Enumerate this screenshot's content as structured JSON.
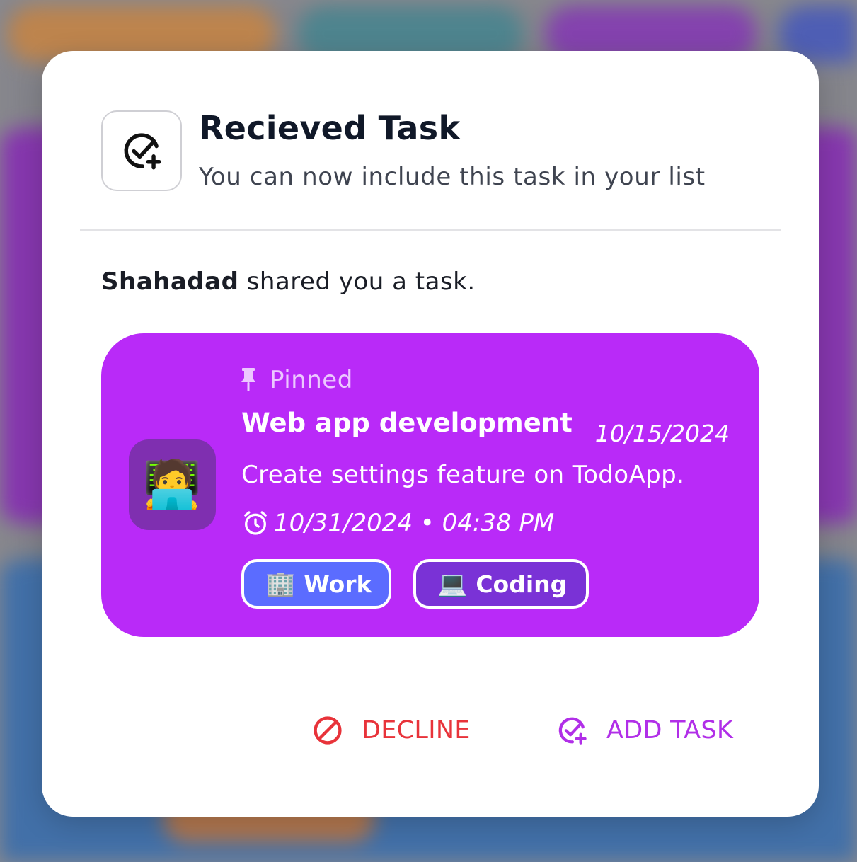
{
  "dialog": {
    "title": "Recieved Task",
    "subtitle": "You can now include this task in your list",
    "sender_name": "Shahadad",
    "shared_text": " shared you a task."
  },
  "task": {
    "pinned_label": "Pinned",
    "title": "Web app development",
    "created_date": "10/15/2024",
    "description": "Create settings feature on TodoApp.",
    "due": "10/31/2024 • 04:38 PM",
    "emoji": "🧑‍💻",
    "color": "#b92af8",
    "categories": [
      {
        "emoji": "🏢",
        "label": "Work",
        "color": "#5b6cff"
      },
      {
        "emoji": "💻",
        "label": "Coding",
        "color": "#7a32d6"
      }
    ]
  },
  "actions": {
    "decline_label": "DECLINE",
    "add_label": "ADD TASK"
  },
  "colors": {
    "decline": "#e8333a",
    "accent": "#b12fe8"
  }
}
